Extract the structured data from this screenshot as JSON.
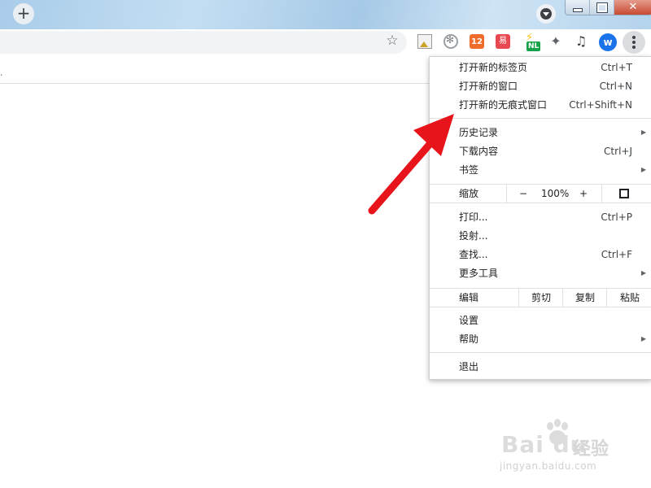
{
  "window": {
    "new_tab_glyph": "+",
    "tab_search_icon": "tab-search-icon",
    "minimize_icon": "minimize-icon",
    "restore_icon": "restore-icon",
    "close_glyph": "✕"
  },
  "toolbar": {
    "bookmark_star_glyph": "☆",
    "extensions": [
      "image-ext-icon",
      "flower-ext-icon",
      "calendar-ext-icon",
      "red-ext-icon",
      "nl-ext-icon",
      "puzzle-icon",
      "media-icon"
    ],
    "calendar_ext_text": "12",
    "red_ext_text": "易",
    "nl_badge": "NL",
    "avatar_letter": "w",
    "puzzle_glyph": "✦",
    "media_glyph": "♫"
  },
  "menu": {
    "new_tab": {
      "label": "打开新的标签页",
      "shortcut": "Ctrl+T"
    },
    "new_window": {
      "label": "打开新的窗口",
      "shortcut": "Ctrl+N"
    },
    "incognito": {
      "label": "打开新的无痕式窗口",
      "shortcut": "Ctrl+Shift+N"
    },
    "history": {
      "label": "历史记录"
    },
    "downloads": {
      "label": "下载内容",
      "shortcut": "Ctrl+J"
    },
    "bookmarks": {
      "label": "书签"
    },
    "zoom": {
      "label": "缩放",
      "minus": "−",
      "value": "100%",
      "plus": "+"
    },
    "print": {
      "label": "打印...",
      "shortcut": "Ctrl+P"
    },
    "cast": {
      "label": "投射..."
    },
    "find": {
      "label": "查找...",
      "shortcut": "Ctrl+F"
    },
    "more_tools": {
      "label": "更多工具"
    },
    "edit": {
      "label": "编辑",
      "cut": "剪切",
      "copy": "复制",
      "paste": "粘贴"
    },
    "settings": {
      "label": "设置"
    },
    "help": {
      "label": "帮助"
    },
    "exit": {
      "label": "退出"
    },
    "submenu_arrow": "▶"
  },
  "colors": {
    "annotation_arrow": "#e8141b",
    "accent": "#1a73e8"
  },
  "watermark": {
    "brand": "Bai du",
    "cn": "经验",
    "url": "jingyan.baidu.com"
  }
}
